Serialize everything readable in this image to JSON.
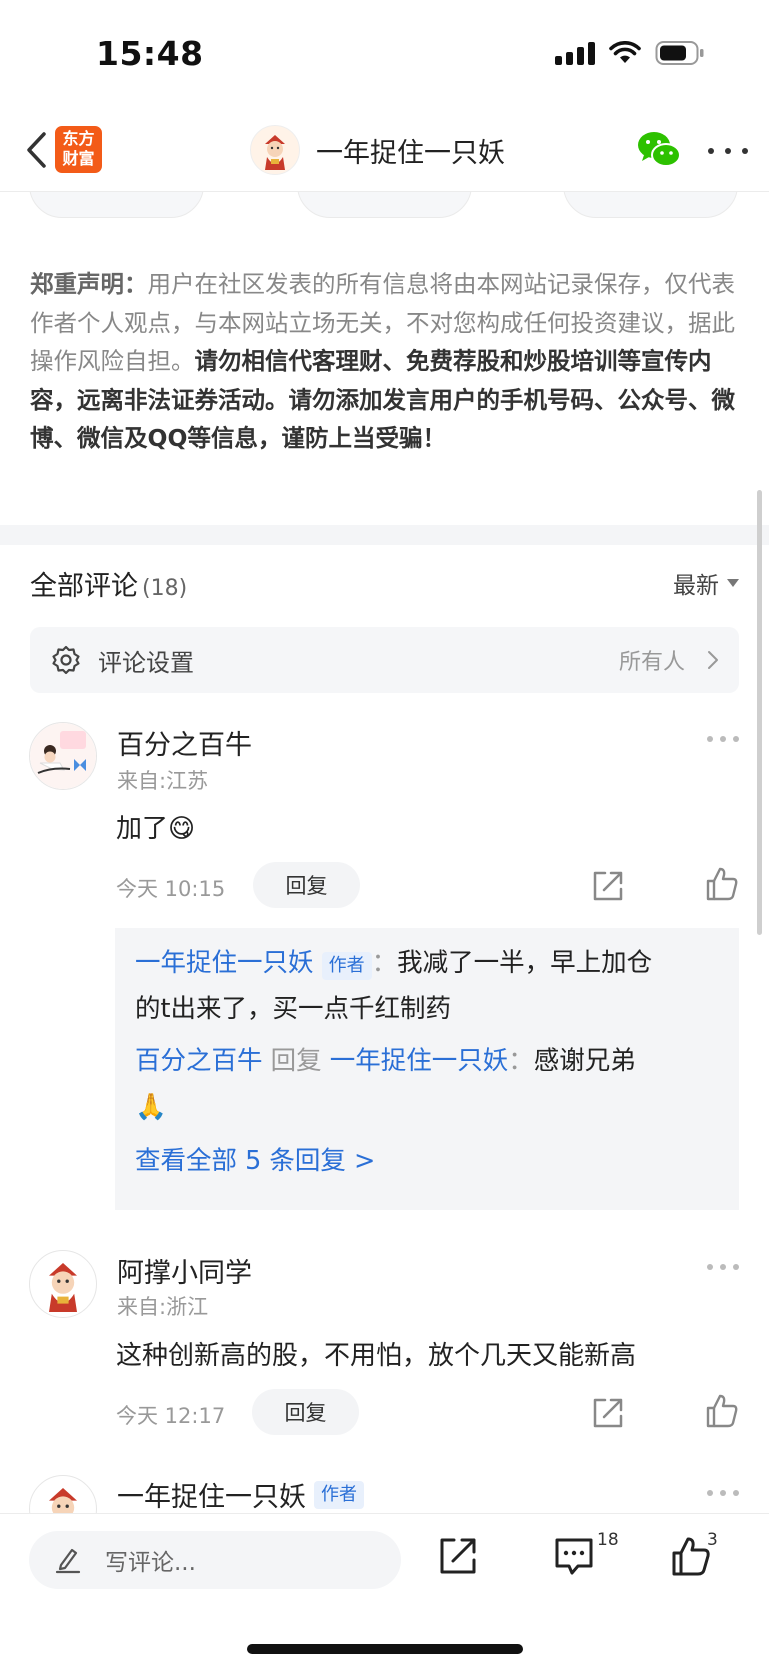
{
  "status_bar": {
    "time": "15:48"
  },
  "nav": {
    "logo_line1": "东方",
    "logo_line2": "财富",
    "title": "一年捉住一只妖",
    "icons": [
      "back-icon",
      "wechat-icon",
      "more-icon"
    ]
  },
  "disclaimer": {
    "lead": "郑重声明：",
    "normal": "用户在社区发表的所有信息将由本网站记录保存，仅代表作者个人观点，与本网站立场无关，不对您构成任何投资建议，据此操作风险自担。",
    "strong": "请勿相信代客理财、免费荐股和炒股培训等宣传内容，远离非法证券活动。请勿添加发言用户的手机号码、公众号、微博、微信及QQ等信息，谨防上当受骗！"
  },
  "comments_header": {
    "title": "全部评论",
    "count": "(18)",
    "sort_label": "最新"
  },
  "settings": {
    "label": "评论设置",
    "value": "所有人"
  },
  "comments": [
    {
      "name": "百分之百牛",
      "location": "来自:江苏",
      "text": "加了😋",
      "time": "今天 10:15",
      "reply_label": "回复",
      "replies": {
        "first_author": "一年捉住一只妖",
        "author_tag": "作者",
        "first_sep": "：",
        "first_text_line1": "我减了一半，早上加仓",
        "first_text_line2": "的t出来了，买一点千红制药",
        "second_user": "百分之百牛",
        "second_action": "回复",
        "second_target": "一年捉住一只妖",
        "second_sep": "：",
        "second_text": "感谢兄弟",
        "second_emoji": "🙏",
        "view_all": "查看全部 5 条回复 >"
      }
    },
    {
      "name": "阿撑小同学",
      "location": "来自:浙江",
      "text": "这种创新高的股，不用怕，放个几天又能新高",
      "time": "今天 12:17",
      "reply_label": "回复"
    },
    {
      "name": "一年捉住一只妖",
      "author_tag": "作者"
    }
  ],
  "bottom_bar": {
    "input_placeholder": "写评论...",
    "comment_count": "18",
    "like_count": "3"
  },
  "colors": {
    "brand": "#f35b18",
    "link": "#2a6fd6",
    "wechat": "#2dc100"
  }
}
